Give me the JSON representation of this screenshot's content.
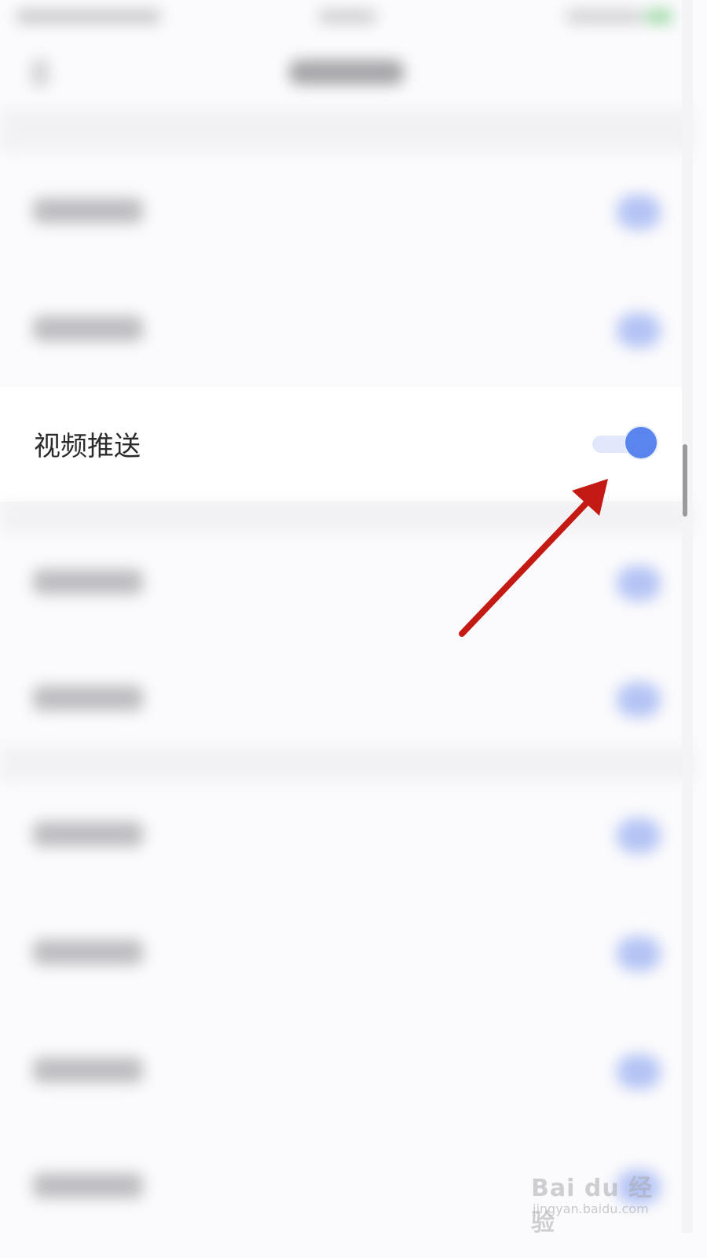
{
  "setting": {
    "label": "视频推送",
    "enabled": true
  },
  "colors": {
    "toggle_on": "#5a84ee",
    "toggle_track": "#e1e8fb",
    "annotation_arrow": "#c41a14"
  },
  "watermark": {
    "text": "Bai du 经验",
    "url": "jingyan.baidu.com"
  }
}
